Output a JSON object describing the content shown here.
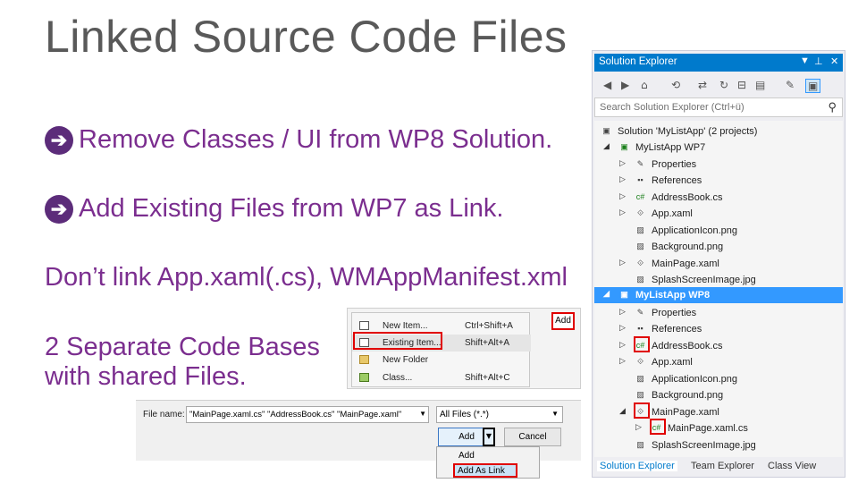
{
  "slide": {
    "title": "Linked Source Code Files",
    "bullet1": "Remove Classes / UI from WP8 Solution.",
    "bullet2": "Add Existing Files from WP7 as Link.",
    "line3": "Don’t link App.xaml(.cs), WMAppManifest.xml",
    "line4a": "2 Separate Code Bases",
    "line4b": "with shared Files.",
    "arrow_glyph": "➔",
    "accent_color": "#7b2e8f"
  },
  "context_menu": {
    "items": [
      {
        "label": "New Item...",
        "shortcut": "Ctrl+Shift+A"
      },
      {
        "label": "Existing Item...",
        "shortcut": "Shift+Alt+A"
      },
      {
        "label": "New Folder",
        "shortcut": ""
      },
      {
        "label": "Class...",
        "shortcut": "Shift+Alt+C"
      }
    ],
    "add_label": "Add"
  },
  "file_dialog": {
    "file_name_label": "File name:",
    "file_name_value": "\"MainPage.xaml.cs\" \"AddressBook.cs\" \"MainPage.xaml\"",
    "file_type_value": "All Files (*.*)",
    "add_button": "Add",
    "cancel_button": "Cancel",
    "dropdown_items": [
      "Add",
      "Add As Link"
    ]
  },
  "solution_explorer": {
    "title": "Solution Explorer",
    "search_placeholder": "Search Solution Explorer (Ctrl+ü)",
    "header_color": "#007acc",
    "rows": [
      {
        "text": "Solution 'MyListApp' (2 projects)"
      },
      {
        "text": "MyListApp WP7"
      },
      {
        "text": "Properties"
      },
      {
        "text": "References"
      },
      {
        "text": "AddressBook.cs"
      },
      {
        "text": "App.xaml"
      },
      {
        "text": "ApplicationIcon.png"
      },
      {
        "text": "Background.png"
      },
      {
        "text": "MainPage.xaml"
      },
      {
        "text": "SplashScreenImage.jpg"
      },
      {
        "text": "MyListApp WP8"
      },
      {
        "text": "Properties"
      },
      {
        "text": "References"
      },
      {
        "text": "AddressBook.cs"
      },
      {
        "text": "App.xaml"
      },
      {
        "text": "ApplicationIcon.png"
      },
      {
        "text": "Background.png"
      },
      {
        "text": "MainPage.xaml"
      },
      {
        "text": "MainPage.xaml.cs"
      },
      {
        "text": "SplashScreenImage.jpg"
      }
    ],
    "tabs": [
      "Solution Explorer",
      "Team Explorer",
      "Class View"
    ]
  }
}
